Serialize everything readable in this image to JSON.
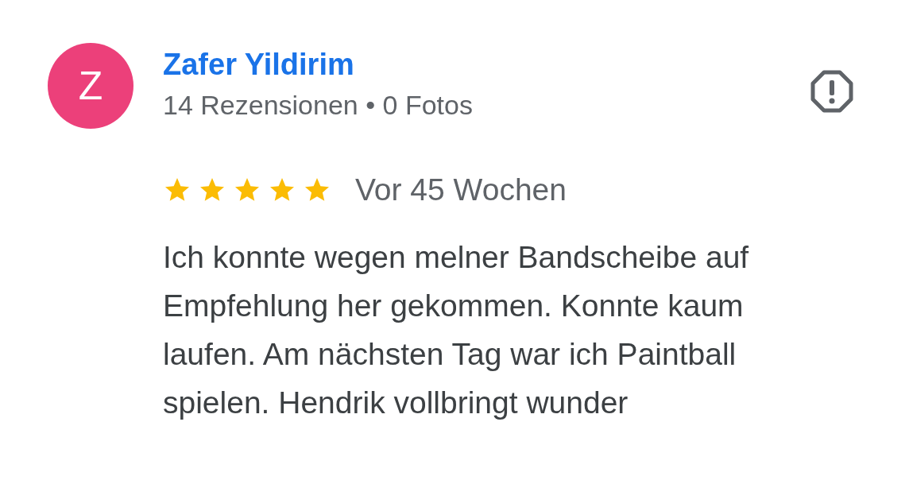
{
  "review": {
    "avatar_letter": "Z",
    "author": "Zafer Yildirim",
    "meta": "14 Rezensionen • 0 Fotos",
    "stars": 5,
    "time": "Vor 45 Wochen",
    "text": "Ich konnte wegen melner Bandscheibe auf Empfehlung her gekommen. Konnte kaum laufen. Am nächsten Tag war ich Paintball spielen. Hendrik vollbringt wunder"
  }
}
